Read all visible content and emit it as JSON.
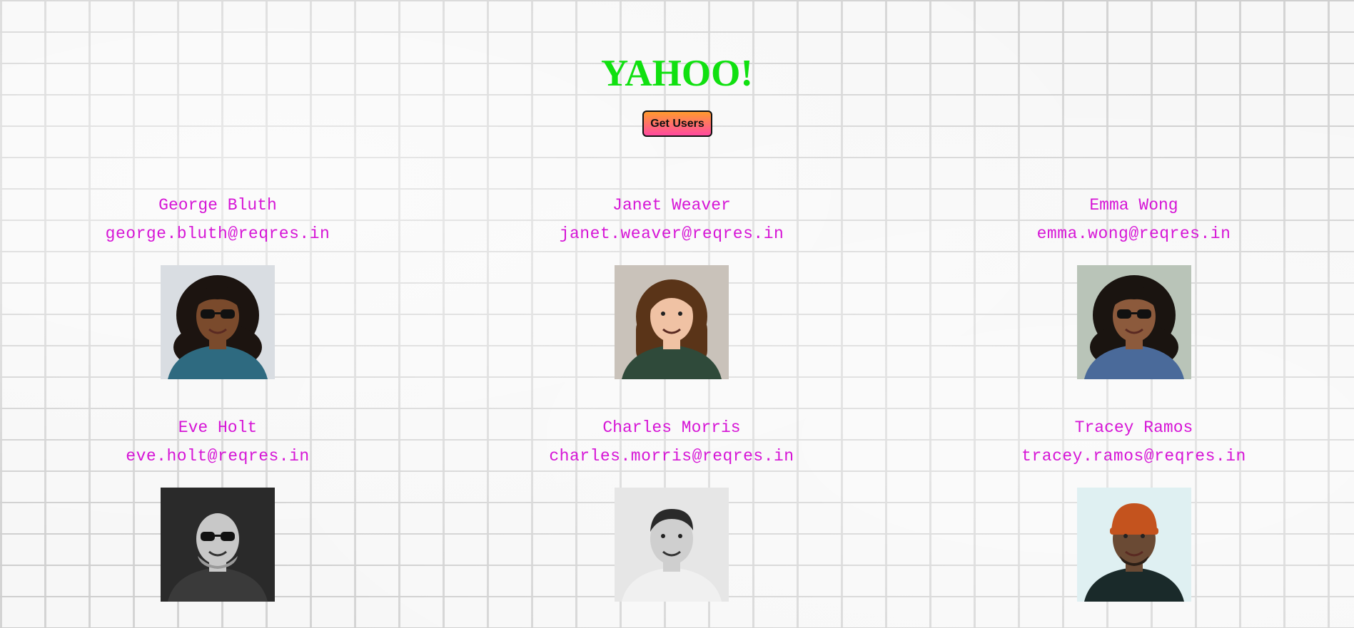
{
  "header": {
    "title": "YAHOO!",
    "button_label": "Get Users"
  },
  "users": [
    {
      "name": "George Bluth",
      "email": "george.bluth@reqres.in",
      "avatar": {
        "bg": "#d9dde2",
        "skin": "#7a4a2c",
        "hair": "#1c1410",
        "shirt": "#2e6a80",
        "glasses": true,
        "hair_style": "curly",
        "grayscale": false
      }
    },
    {
      "name": "Janet Weaver",
      "email": "janet.weaver@reqres.in",
      "avatar": {
        "bg": "#c9c2ba",
        "skin": "#f0c2a4",
        "hair": "#5a3418",
        "shirt": "#2f4a3a",
        "glasses": false,
        "hair_style": "long",
        "grayscale": false
      }
    },
    {
      "name": "Emma Wong",
      "email": "emma.wong@reqres.in",
      "avatar": {
        "bg": "#b9c4b8",
        "skin": "#8c5a3c",
        "hair": "#1a1410",
        "shirt": "#4a6a9a",
        "glasses": true,
        "hair_style": "curly",
        "grayscale": false
      }
    },
    {
      "name": "Eve Holt",
      "email": "eve.holt@reqres.in",
      "avatar": {
        "bg": "#2a2a2a",
        "skin": "#c8c8c8",
        "hair": "#9a9a9a",
        "shirt": "#3a3a3a",
        "glasses": true,
        "hair_style": "bald",
        "grayscale": true
      }
    },
    {
      "name": "Charles Morris",
      "email": "charles.morris@reqres.in",
      "avatar": {
        "bg": "#e6e6e6",
        "skin": "#cfcfcf",
        "hair": "#2a2a2a",
        "shirt": "#f0f0f0",
        "glasses": false,
        "hair_style": "short",
        "grayscale": true
      }
    },
    {
      "name": "Tracey Ramos",
      "email": "tracey.ramos@reqres.in",
      "avatar": {
        "bg": "#dff0f2",
        "skin": "#6a4a34",
        "hair": "#c4531e",
        "shirt": "#1a2a2a",
        "glasses": false,
        "hair_style": "beanie",
        "grayscale": false
      }
    }
  ]
}
